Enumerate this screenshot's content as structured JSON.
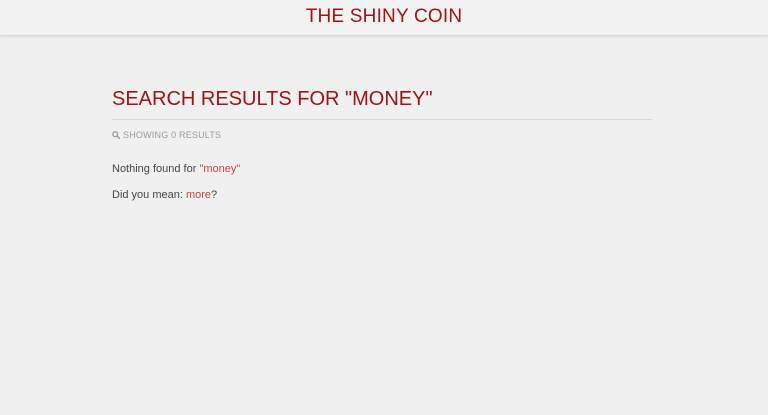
{
  "header": {
    "site_title": "THE SHINY COIN"
  },
  "search": {
    "heading": "SEARCH RESULTS FOR \"MONEY\"",
    "results_count": "SHOWING 0 RESULTS",
    "not_found_prefix": "Nothing found for ",
    "query_quoted": "\"money\"",
    "suggest_prefix": "Did you mean: ",
    "suggestion": "more",
    "suggest_suffix": "?"
  },
  "icons": {
    "results_icon": "search-icon"
  },
  "colors": {
    "brand": "#a01318",
    "accent": "#c8453e",
    "background": "#f0f0f0"
  }
}
